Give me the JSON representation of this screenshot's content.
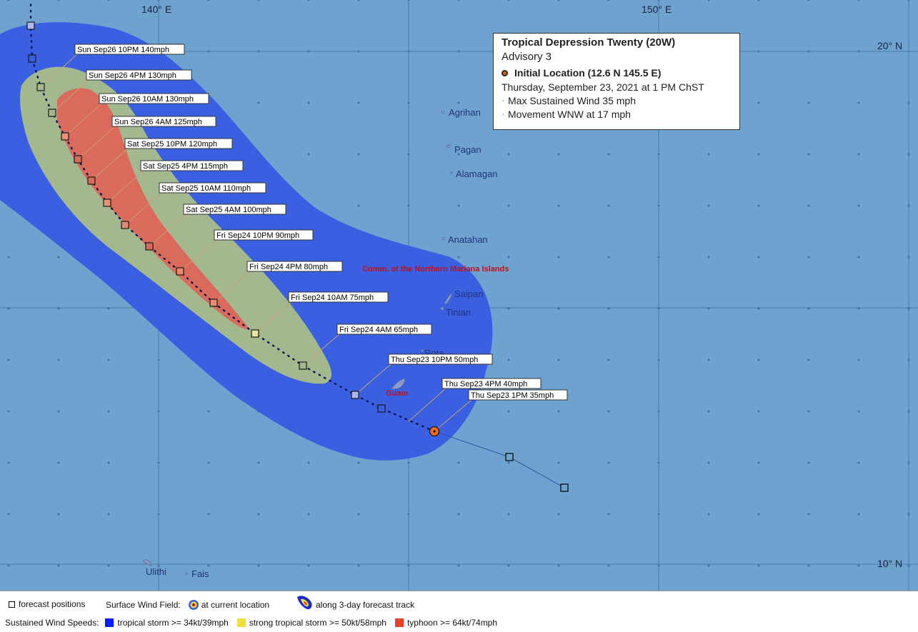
{
  "grid_labels": {
    "lon_140": "140° E",
    "lon_150": "150° E",
    "lat_20": "20° N",
    "lat_10": "10° N"
  },
  "info": {
    "title": "Tropical Depression Twenty (20W)",
    "advisory": "Advisory 3",
    "initial_location": "Initial Location (12.6 N 145.5 E)",
    "datetime": "Thursday, September 23, 2021 at 1 PM ChST",
    "max_wind": "Max Sustained Wind 35 mph",
    "movement": "Movement WNW at 17 mph"
  },
  "forecast_points": [
    {
      "label": "Thu Sep23 1PM  35mph"
    },
    {
      "label": "Thu Sep23 4PM  40mph"
    },
    {
      "label": "Thu Sep23 10PM  50mph"
    },
    {
      "label": "Fri Sep24 4AM  65mph"
    },
    {
      "label": "Fri Sep24 10AM  75mph"
    },
    {
      "label": "Fri Sep24 4PM  80mph"
    },
    {
      "label": "Fri Sep24 10PM  90mph"
    },
    {
      "label": "Sat Sep25 4AM  100mph"
    },
    {
      "label": "Sat Sep25 10AM  110mph"
    },
    {
      "label": "Sat Sep25 4PM  115mph"
    },
    {
      "label": "Sat Sep25 10PM  120mph"
    },
    {
      "label": "Sun Sep26 4AM  125mph"
    },
    {
      "label": "Sun Sep26 10AM  130mph"
    },
    {
      "label": "Sun Sep26 4PM  130mph"
    },
    {
      "label": "Sun Sep26 10PM  140mph"
    }
  ],
  "islands": {
    "agrihan": "Agrihan",
    "pagan": "Pagan",
    "alamagan": "Alamagan",
    "anatahan": "Anatahan",
    "saipan": "Saipan",
    "tinian": "Tinian",
    "rota": "Rota",
    "guam": "Guam",
    "ulithi": "Ulithi",
    "fais": "Fais"
  },
  "region_label": "Comm. of the Northern Mariana Islands",
  "legend": {
    "forecast_positions": "forecast positions",
    "surface_wind_field": "Surface Wind Field:",
    "at_current_location": "at current location",
    "along_forecast_track": "along 3-day forecast track",
    "sustained_wind_speeds": "Sustained Wind Speeds:",
    "tropical_storm": "tropical storm >= 34kt/39mph",
    "strong_tropical_storm": "strong tropical storm >= 50kt/58mph",
    "typhoon": "typhoon >= 64kt/74mph"
  },
  "colors": {
    "ocean": "#6fa3cf",
    "tropical_storm": "#0000ff",
    "strong_tropical_storm": "#f0e040",
    "typhoon": "#e8402a",
    "current_location": "#f26a1b"
  }
}
